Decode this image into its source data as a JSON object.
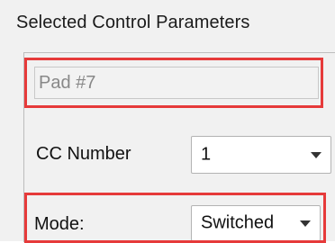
{
  "panel": {
    "title": "Selected Control Parameters"
  },
  "name_field": {
    "value": "Pad #7"
  },
  "cc_number": {
    "label": "CC Number",
    "selected": "1",
    "caret_icon": "chevron-down-icon"
  },
  "mode": {
    "label": "Mode:",
    "selected": "Switched",
    "caret_icon": "chevron-down-icon"
  },
  "colors": {
    "highlight": "#e63a3a",
    "panel_background": "#f1f1f1",
    "disabled_text": "#888888"
  }
}
